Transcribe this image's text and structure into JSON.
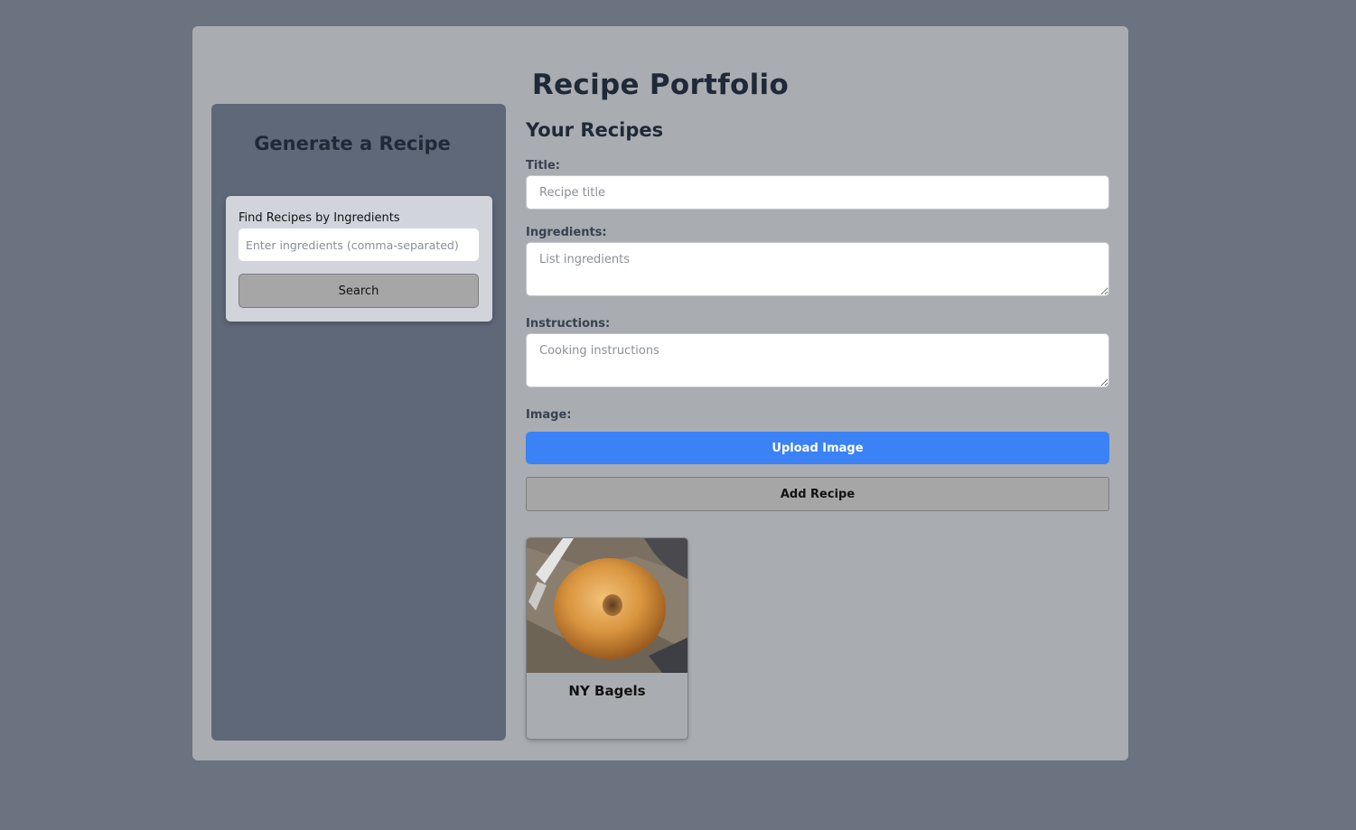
{
  "header": {
    "title": "Recipe Portfolio"
  },
  "sidebar": {
    "title": "Generate a Recipe",
    "search": {
      "label": "Find Recipes by Ingredients",
      "placeholder": "Enter ingredients (comma-separated)",
      "value": "",
      "button_label": "Search"
    }
  },
  "main": {
    "title": "Your Recipes",
    "form": {
      "title_label": "Title:",
      "title_placeholder": "Recipe title",
      "ingredients_label": "Ingredients:",
      "ingredients_placeholder": "List ingredients",
      "instructions_label": "Instructions:",
      "instructions_placeholder": "Cooking instructions",
      "image_label": "Image:",
      "upload_label": "Upload Image",
      "add_label": "Add Recipe"
    },
    "recipes": [
      {
        "name": "NY Bagels",
        "image": "bagel-photo"
      }
    ]
  },
  "colors": {
    "page_background": "#6b7280",
    "container_background": "#a9acb1",
    "sidebar_background": "#5f6878",
    "accent": "#3b82f6",
    "button_gray": "#a6a6a6",
    "heading": "#1f2937"
  }
}
